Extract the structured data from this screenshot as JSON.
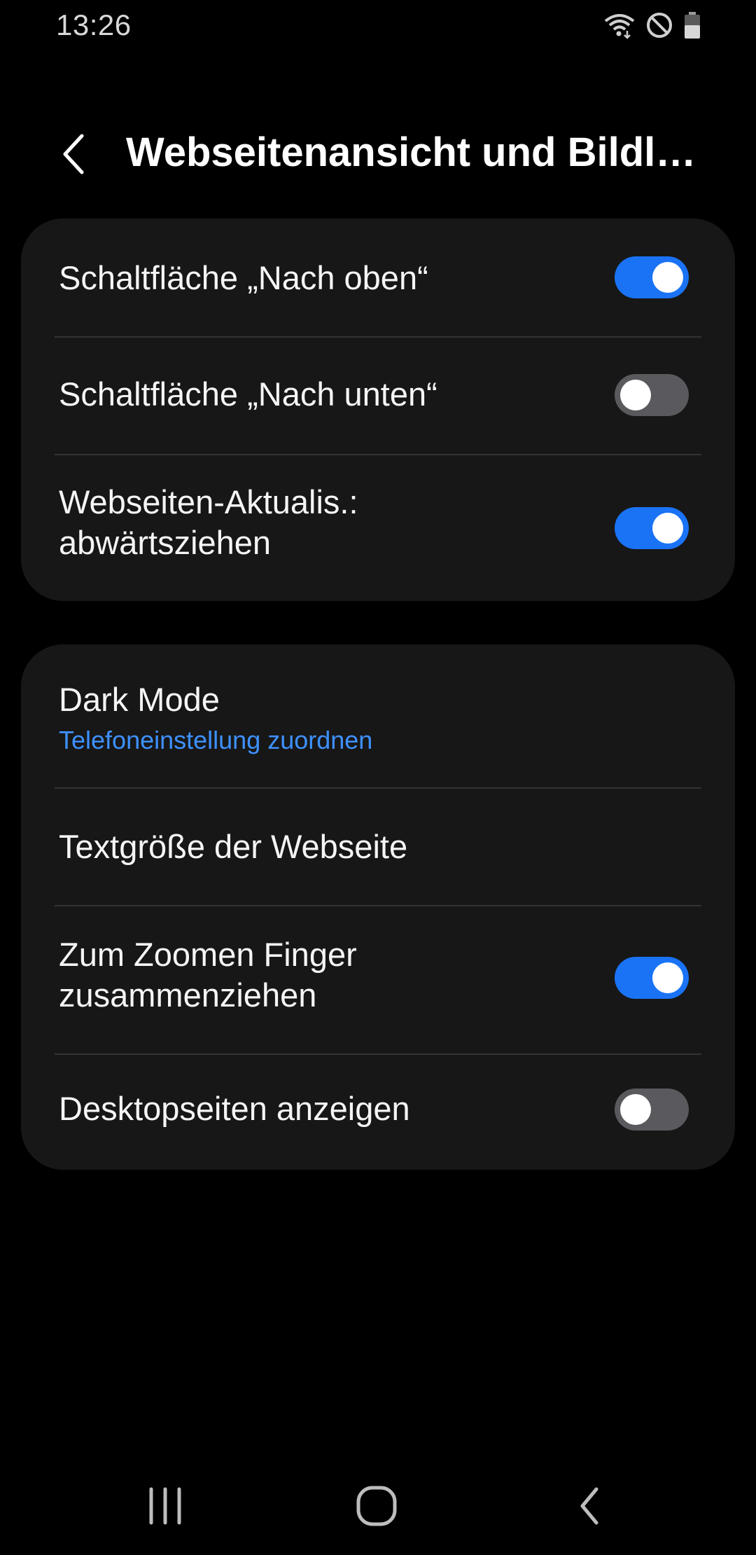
{
  "status_bar": {
    "time": "13:26",
    "icons": [
      "wifi-icon",
      "do-not-disturb-icon",
      "battery-icon"
    ]
  },
  "header": {
    "title": "Webseitenansicht und Bildlauf",
    "back_icon": "back-arrow-icon"
  },
  "colors": {
    "background": "#000000",
    "card": "#171717",
    "accent": "#1a73f5",
    "link": "#3e91ff",
    "toggle_off": "#5a5a5e"
  },
  "group1": {
    "items": [
      {
        "label": "Schaltfläche „Nach oben“",
        "toggle": true
      },
      {
        "label": "Schaltfläche „Nach unten“",
        "toggle": false
      },
      {
        "label_line1": "Webseiten-Aktualis.:",
        "label_line2": "abwärtsziehen",
        "toggle": true
      }
    ]
  },
  "group2": {
    "items": [
      {
        "label": "Dark Mode",
        "sublabel": "Telefoneinstellung zuordnen"
      },
      {
        "label": "Textgröße der Webseite"
      },
      {
        "label_line1": "Zum Zoomen Finger",
        "label_line2": "zusammenziehen",
        "toggle": true
      },
      {
        "label": "Desktopseiten anzeigen",
        "toggle": false
      }
    ]
  },
  "nav_bar": {
    "buttons": [
      "recent-apps-icon",
      "home-icon",
      "back-icon"
    ]
  }
}
